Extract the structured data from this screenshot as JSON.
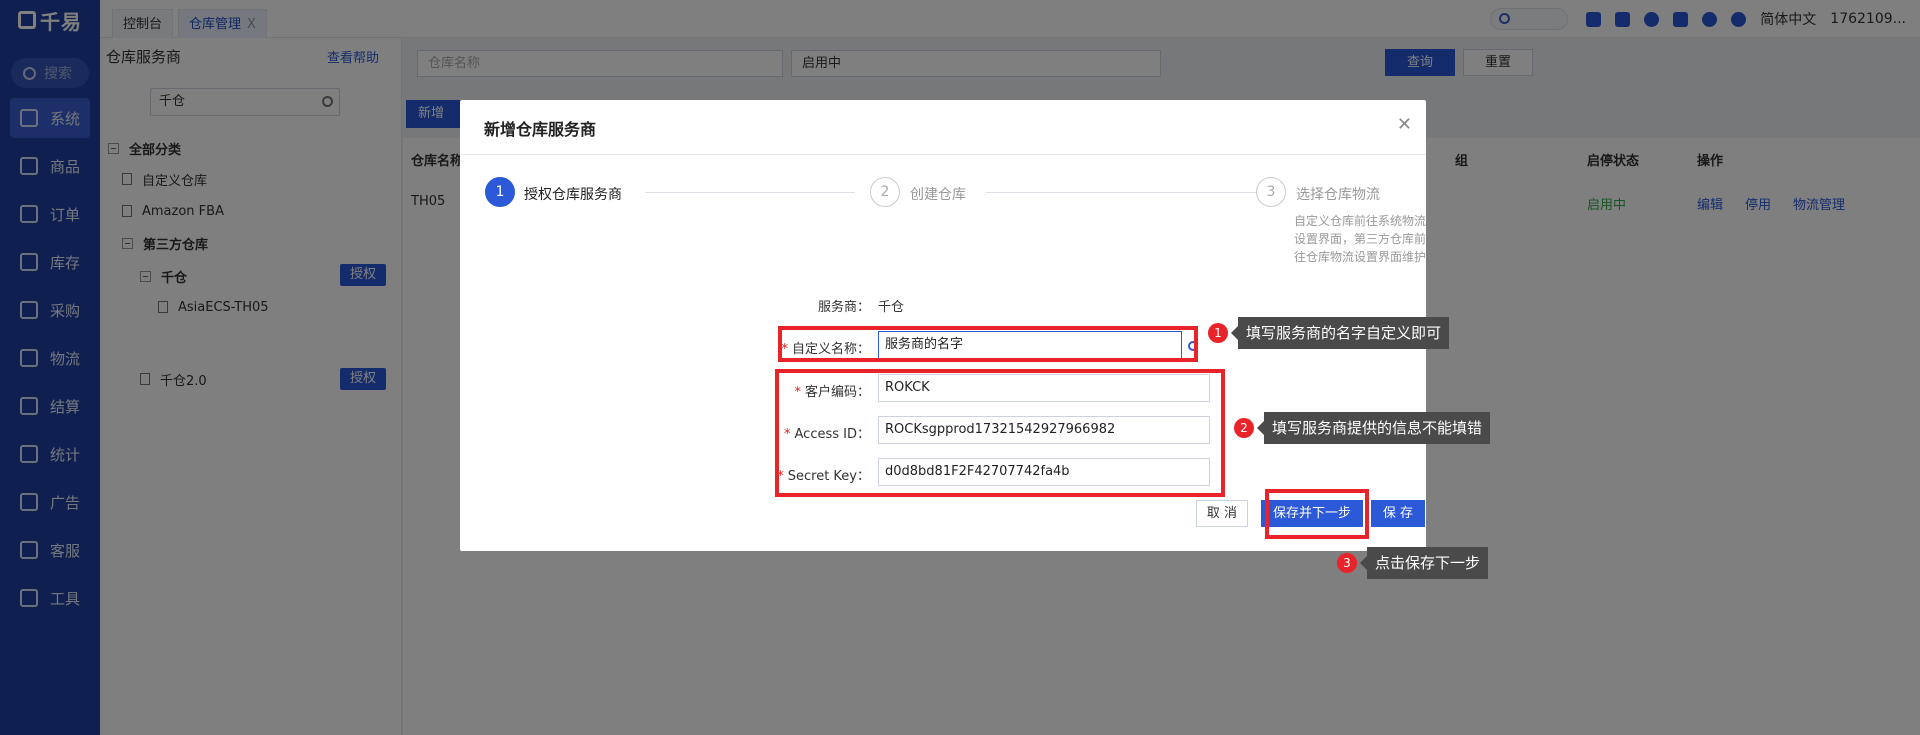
{
  "sidebar": {
    "logo": "千易",
    "search": "搜索",
    "items": [
      {
        "label": "系统",
        "icon": "system-icon"
      },
      {
        "label": "商品",
        "icon": "product-icon"
      },
      {
        "label": "订单",
        "icon": "order-icon"
      },
      {
        "label": "库存",
        "icon": "inventory-icon"
      },
      {
        "label": "采购",
        "icon": "cart-icon"
      },
      {
        "label": "物流",
        "icon": "truck-icon"
      },
      {
        "label": "结算",
        "icon": "settlement-icon"
      },
      {
        "label": "统计",
        "icon": "stats-icon"
      },
      {
        "label": "广告",
        "icon": "ad-icon"
      },
      {
        "label": "客服",
        "icon": "headset-icon"
      },
      {
        "label": "工具",
        "icon": "tools-icon"
      }
    ]
  },
  "topbar": {
    "tabs": [
      {
        "label": "控制台"
      },
      {
        "label": "仓库管理"
      }
    ],
    "tab_close": "X",
    "language": "简体中文",
    "user": "1762109..."
  },
  "left_panel": {
    "title": "仓库服务商",
    "help": "查看帮助",
    "search_value": "千仓",
    "tree": {
      "root": "全部分类",
      "custom": "自定义仓库",
      "amazon": "Amazon FBA",
      "third_party": "第三方仓库",
      "qiancang": "千仓",
      "asia": "AsiaECS-TH05",
      "qiancang2": "千仓2.0",
      "auth_label": "授权"
    }
  },
  "main": {
    "filter_name_placeholder": "仓库名称",
    "filter_status": "启用中",
    "query": "查询",
    "reset": "重置",
    "new_button": "新增",
    "columns": {
      "name": "仓库名称",
      "group": "组",
      "status": "启停状态",
      "actions": "操作"
    },
    "row": {
      "name": "TH05",
      "status": "启用中",
      "edit": "编辑",
      "disable": "停用",
      "logistics": "物流管理"
    }
  },
  "modal": {
    "title": "新增仓库服务商",
    "steps": [
      {
        "num": "1",
        "label": "授权仓库服务商"
      },
      {
        "num": "2",
        "label": "创建仓库"
      },
      {
        "num": "3",
        "label": "选择仓库物流"
      }
    ],
    "step3_desc": "自定义仓库前往系统物流设置界面，第三方仓库前往仓库物流设置界面维护",
    "provider_label": "服务商：",
    "provider_value": "千仓",
    "fields": {
      "custom_name": {
        "label": "自定义名称：",
        "value": "服务商的名字"
      },
      "customer_code": {
        "label": "客户编码：",
        "value": "ROKCK"
      },
      "access_id": {
        "label": "Access ID：",
        "value": "ROCKsgpprod17321542927966982"
      },
      "secret_key": {
        "label": "Secret Key：",
        "value": "d0d8bd81F2F42707742fa4b"
      }
    },
    "required_mark": "*",
    "cancel": "取 消",
    "save_next": "保存并下一步",
    "save": "保 存"
  },
  "annotations": [
    {
      "num": "1",
      "text": "填写服务商的名字自定义即可"
    },
    {
      "num": "2",
      "text": "填写服务商提供的信息不能填错"
    },
    {
      "num": "3",
      "text": "点击保存下一步"
    }
  ],
  "colors": {
    "brand": "#2b59d8",
    "sidebar": "#1f3fa0",
    "highlight": "#e8232a",
    "success": "#2ea84b"
  }
}
